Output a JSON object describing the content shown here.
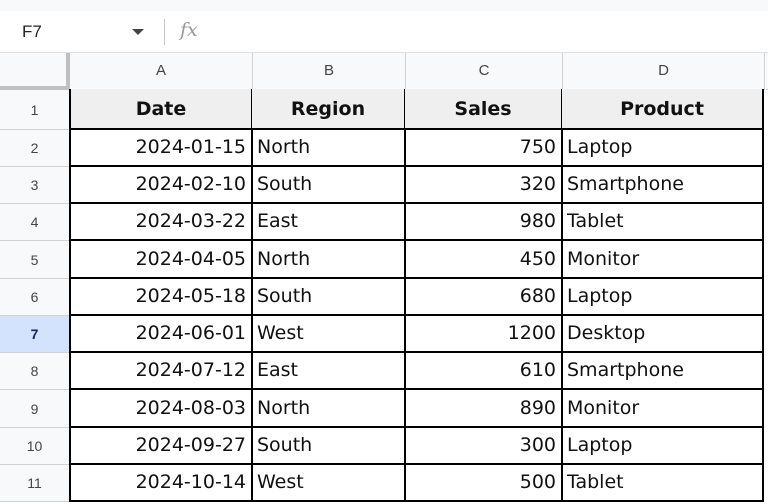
{
  "formula_bar": {
    "name_box": "F7",
    "fx_label": "fx",
    "formula": ""
  },
  "columns": [
    "A",
    "B",
    "C",
    "D"
  ],
  "rows": [
    "1",
    "2",
    "3",
    "4",
    "5",
    "6",
    "7",
    "8",
    "9",
    "10",
    "11"
  ],
  "selected_row": "7",
  "table": {
    "headers": [
      "Date",
      "Region",
      "Sales",
      "Product"
    ],
    "data": [
      [
        "2024-01-15",
        "North",
        "750",
        "Laptop"
      ],
      [
        "2024-02-10",
        "South",
        "320",
        "Smartphone"
      ],
      [
        "2024-03-22",
        "East",
        "980",
        "Tablet"
      ],
      [
        "2024-04-05",
        "North",
        "450",
        "Monitor"
      ],
      [
        "2024-05-18",
        "South",
        "680",
        "Laptop"
      ],
      [
        "2024-06-01",
        "West",
        "1200",
        "Desktop"
      ],
      [
        "2024-07-12",
        "East",
        "610",
        "Smartphone"
      ],
      [
        "2024-08-03",
        "North",
        "890",
        "Monitor"
      ],
      [
        "2024-09-27",
        "South",
        "300",
        "Laptop"
      ],
      [
        "2024-10-14",
        "West",
        "500",
        "Tablet"
      ]
    ]
  }
}
